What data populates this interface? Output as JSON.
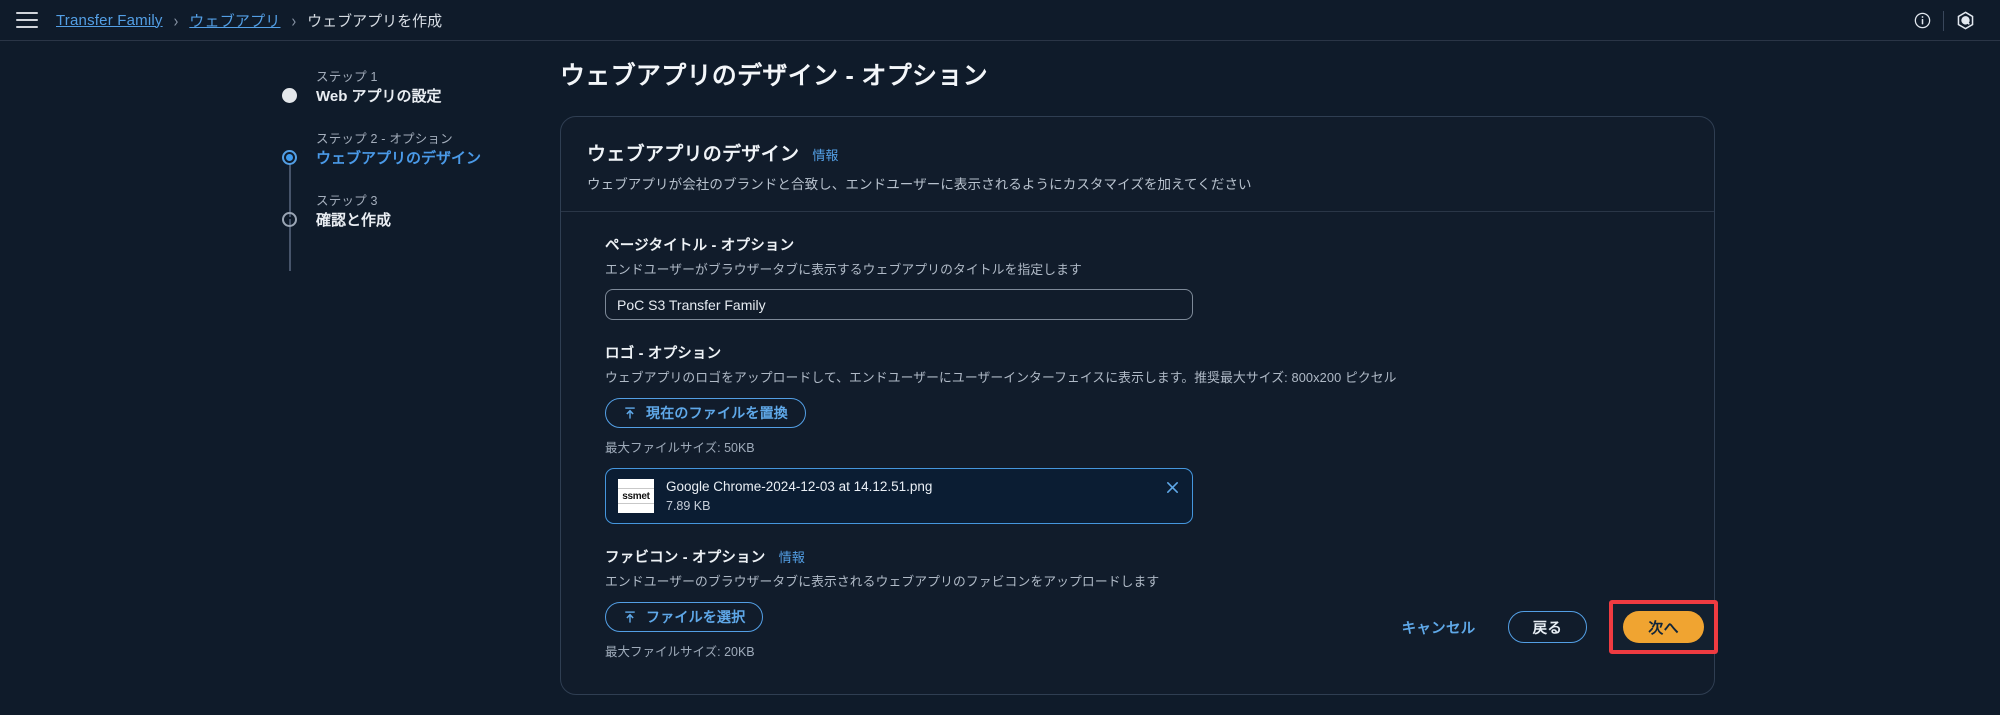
{
  "topbar": {
    "menu_icon": "hamburger-icon",
    "breadcrumb": [
      {
        "label": "Transfer Family",
        "link": true
      },
      {
        "label": "ウェブアプリ",
        "link": true
      },
      {
        "label": "ウェブアプリを作成",
        "link": false
      }
    ],
    "separator": "›",
    "info_icon": "info-circle-icon",
    "settings_icon": "hexagon-q-icon"
  },
  "steps": [
    {
      "kicker": "ステップ 1",
      "title": "Web アプリの設定",
      "state": "done"
    },
    {
      "kicker": "ステップ 2 - オプション",
      "title": "ウェブアプリのデザイン",
      "state": "current"
    },
    {
      "kicker": "ステップ 3",
      "title": "確認と作成",
      "state": "todo"
    }
  ],
  "main": {
    "page_title": "ウェブアプリのデザイン - オプション",
    "card": {
      "title": "ウェブアプリのデザイン",
      "info_label": "情報",
      "subtitle": "ウェブアプリが会社のブランドと合致し、エンドユーザーに表示されるようにカスタマイズを加えてください"
    },
    "page_title_field": {
      "label": "ページタイトル - オプション",
      "description": "エンドユーザーがブラウザータブに表示するウェブアプリのタイトルを指定します",
      "value": "PoC S3 Transfer Family",
      "placeholder": ""
    },
    "logo_field": {
      "label": "ロゴ - オプション",
      "description": "ウェブアプリのロゴをアップロードして、エンドユーザーにユーザーインターフェイスに表示します。推奨最大サイズ: 800x200 ピクセル",
      "button_label": "現在のファイルを置換",
      "button_icon": "upload-icon",
      "max_size_hint": "最大ファイルサイズ: 50KB",
      "file": {
        "name": "Google Chrome-2024-12-03 at 14.12.51.png",
        "size": "7.89 KB",
        "thumbnail_text": "ssmet",
        "remove_icon": "close-icon"
      }
    },
    "favicon_field": {
      "label": "ファビコン - オプション",
      "info_label": "情報",
      "description": "エンドユーザーのブラウザータブに表示されるウェブアプリのファビコンをアップロードします",
      "button_label": "ファイルを選択",
      "button_icon": "upload-icon",
      "max_size_hint": "最大ファイルサイズ: 20KB"
    }
  },
  "actions": {
    "cancel_label": "キャンセル",
    "back_label": "戻る",
    "next_label": "次へ",
    "next_highlight_color": "#ef3b41",
    "next_button_color": "#f0a431"
  }
}
